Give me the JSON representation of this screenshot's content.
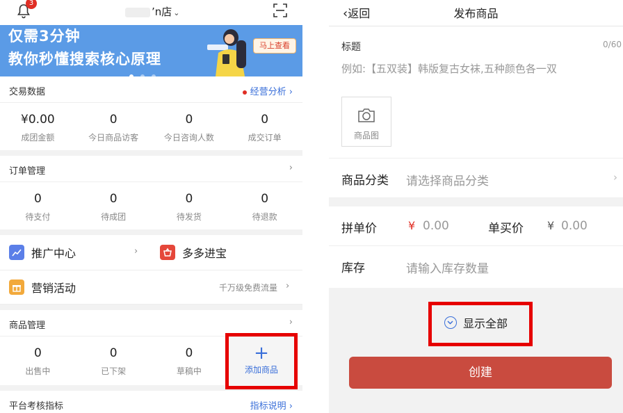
{
  "left": {
    "header": {
      "badge_count": "3",
      "shop_name": "ʼn店"
    },
    "banner": {
      "line1": "仅需3分钟",
      "line2": "教你秒懂搜索核心原理",
      "button": "马上查看"
    },
    "trade": {
      "title": "交易数据",
      "link": "经营分析 ›",
      "stats": [
        {
          "value": "¥0.00",
          "label": "成团金额"
        },
        {
          "value": "0",
          "label": "今日商品访客"
        },
        {
          "value": "0",
          "label": "今日咨询人数"
        },
        {
          "value": "0",
          "label": "成交订单"
        }
      ]
    },
    "orders": {
      "title": "订单管理",
      "stats": [
        {
          "value": "0",
          "label": "待支付"
        },
        {
          "value": "0",
          "label": "待成团"
        },
        {
          "value": "0",
          "label": "待发货"
        },
        {
          "value": "0",
          "label": "待退款"
        }
      ]
    },
    "tools": {
      "promo": "推广中心",
      "treasure": "多多进宝",
      "marketing": "营销活动",
      "marketing_hint": "千万级免费流量"
    },
    "goods": {
      "title": "商品管理",
      "stats": [
        {
          "value": "0",
          "label": "出售中"
        },
        {
          "value": "0",
          "label": "已下架"
        },
        {
          "value": "0",
          "label": "草稿中"
        }
      ],
      "add_label": "添加商品",
      "add_symbol": "+"
    },
    "platform": {
      "title": "平台考核指标",
      "link": "指标说明 ›"
    }
  },
  "right": {
    "back": "返回",
    "title": "发布商品",
    "title_field": {
      "label": "标题",
      "count": "0/60",
      "placeholder": "例如:【五双装】韩版复古女袜,五种颜色各一双"
    },
    "photo_label": "商品图",
    "category": {
      "label": "商品分类",
      "placeholder": "请选择商品分类"
    },
    "group_price": {
      "label": "拼单价",
      "currency": "¥",
      "value": "0.00"
    },
    "single_price": {
      "label": "单买价",
      "currency": "¥",
      "value": "0.00"
    },
    "stock": {
      "label": "库存",
      "placeholder": "请输入库存数量"
    },
    "show_all": "显示全部",
    "create": "创建"
  }
}
